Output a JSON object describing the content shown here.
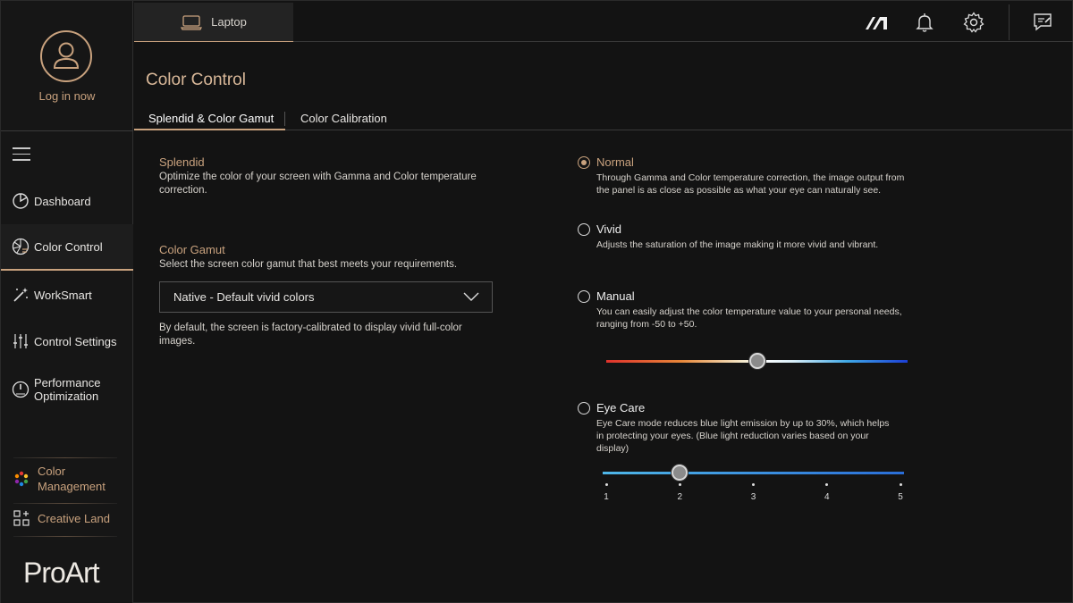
{
  "profile": {
    "login_label": "Log in now"
  },
  "sidebar": {
    "items": [
      {
        "label": "Dashboard",
        "icon": "pie-chart-icon"
      },
      {
        "label": "Color Control",
        "icon": "color-wheel-icon",
        "active": true
      },
      {
        "label": "WorkSmart",
        "icon": "magic-wand-icon"
      },
      {
        "label": "Control Settings",
        "icon": "sliders-icon"
      },
      {
        "label": "Performance Optimization",
        "line1": "Performance",
        "line2": "Optimization",
        "icon": "gauge-icon"
      }
    ],
    "sub_items": [
      {
        "label": "Color Management",
        "line1": "Color",
        "line2": "Management",
        "icon": "color-palette-icon"
      },
      {
        "label": "Creative Land",
        "icon": "apps-grid-icon"
      }
    ],
    "logo": "ProArt"
  },
  "topbar": {
    "device_label": "Laptop",
    "icons": [
      "asus-logo-icon",
      "bell-icon",
      "gear-icon",
      "feedback-icon"
    ]
  },
  "main": {
    "title": "Color Control",
    "tabs": [
      {
        "label": "Splendid & Color Gamut",
        "active": true
      },
      {
        "label": "Color Calibration"
      }
    ],
    "splendid": {
      "title": "Splendid",
      "description": "Optimize the color of your screen with Gamma and Color temperature correction."
    },
    "gamut": {
      "title": "Color Gamut",
      "description": "Select the screen color gamut that best meets your requirements.",
      "selected": "Native - Default vivid colors",
      "note": "By default, the screen is factory-calibrated to display vivid full-color images."
    },
    "modes": [
      {
        "title": "Normal",
        "selected": true,
        "description": "Through Gamma and Color temperature correction, the image output from the panel is as close as possible as what your eye can naturally see."
      },
      {
        "title": "Vivid",
        "selected": false,
        "description": "Adjusts the saturation of the image making it more vivid and vibrant."
      },
      {
        "title": "Manual",
        "selected": false,
        "description": "You can easily adjust the color temperature value to your personal needs, ranging from -50 to +50."
      },
      {
        "title": "Eye Care",
        "selected": false,
        "description": "Eye Care mode reduces blue light emission by up to 30%, which helps in protecting your eyes. (Blue light reduction varies based on your display)"
      }
    ],
    "manual_slider": {
      "min": -50,
      "max": 50,
      "value": 0
    },
    "eye_care_slider": {
      "ticks": [
        "1",
        "2",
        "3",
        "4",
        "5"
      ],
      "value": 2
    }
  },
  "colors": {
    "accent": "#c9a27e",
    "background": "#131313"
  }
}
